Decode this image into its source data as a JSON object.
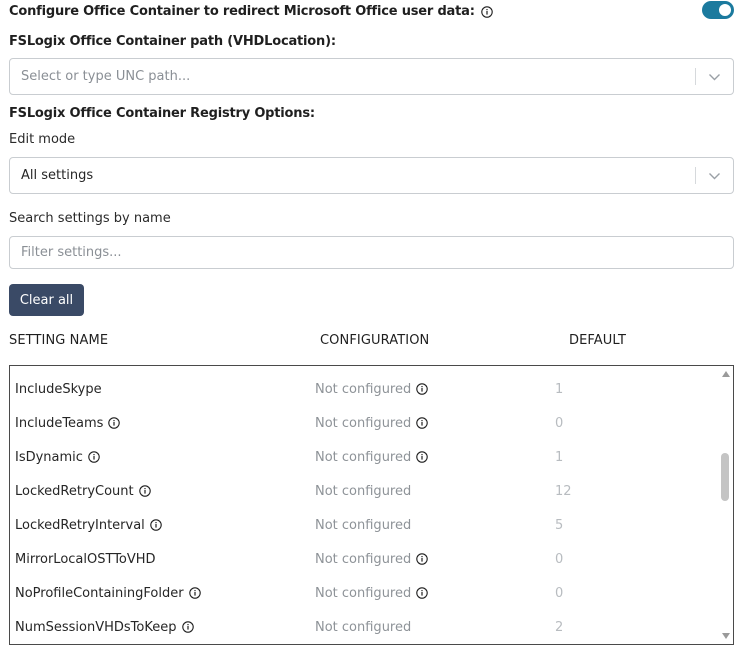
{
  "office_container": {
    "label": "Configure Office Container to redirect Microsoft Office user data:",
    "toggle_on": true,
    "accent_color": "#1b7a9e"
  },
  "vhd_location": {
    "label": "FSLogix Office Container path (VHDLocation):",
    "placeholder": "Select or type UNC path..."
  },
  "registry_options": {
    "label": "FSLogix Office Container Registry Options:"
  },
  "edit_mode": {
    "label": "Edit mode",
    "value": "All settings"
  },
  "search": {
    "label": "Search settings by name",
    "placeholder": "Filter settings..."
  },
  "clear_all": {
    "label": "Clear all",
    "color": "#3a4a66"
  },
  "table": {
    "headers": {
      "name": "SETTING NAME",
      "configuration": "CONFIGURATION",
      "default": "DEFAULT"
    },
    "rows": [
      {
        "name": "IncludeSkype",
        "name_info": false,
        "config": "Not configured",
        "config_info": true,
        "default": "1"
      },
      {
        "name": "IncludeTeams",
        "name_info": true,
        "config": "Not configured",
        "config_info": true,
        "default": "0"
      },
      {
        "name": "IsDynamic",
        "name_info": true,
        "config": "Not configured",
        "config_info": true,
        "default": "1"
      },
      {
        "name": "LockedRetryCount",
        "name_info": true,
        "config": "Not configured",
        "config_info": false,
        "default": "12"
      },
      {
        "name": "LockedRetryInterval",
        "name_info": true,
        "config": "Not configured",
        "config_info": false,
        "default": "5"
      },
      {
        "name": "MirrorLocalOSTToVHD",
        "name_info": false,
        "config": "Not configured",
        "config_info": true,
        "default": "0"
      },
      {
        "name": "NoProfileContainingFolder",
        "name_info": true,
        "config": "Not configured",
        "config_info": true,
        "default": "0"
      },
      {
        "name": "NumSessionVHDsToKeep",
        "name_info": true,
        "config": "Not configured",
        "config_info": false,
        "default": "2"
      }
    ]
  }
}
